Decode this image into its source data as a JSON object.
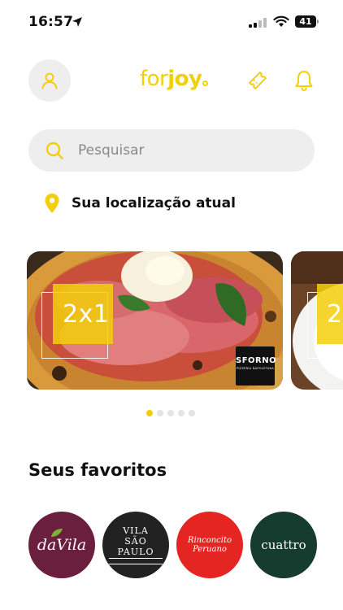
{
  "status_bar": {
    "time": "16:57",
    "battery": "41"
  },
  "header": {
    "logo_regular": "for",
    "logo_bold": "joy",
    "accent_color": "#f2cf0a"
  },
  "search": {
    "placeholder": "Pesquisar",
    "value": ""
  },
  "location": {
    "label": "Sua localização atual"
  },
  "carousel": {
    "banners": [
      {
        "promo": "2x1",
        "brand": "SFORNO",
        "brand_sub": "PIZZERIA NAPOLETANA"
      },
      {
        "promo": "2"
      }
    ],
    "page_count": 5,
    "active_index": 0
  },
  "favorites": {
    "title": "Seus favoritos",
    "items": [
      {
        "name": "daVila",
        "color": "#6b1f3e"
      },
      {
        "name": "VILA",
        "name_2": "SÃO PAULO",
        "color": "#222222"
      },
      {
        "name": "Rinconcito",
        "name_2": "Peruano",
        "color": "#e52521"
      },
      {
        "name": "cuattro",
        "color": "#153c2e"
      }
    ]
  },
  "icons": {
    "profile": "user-icon",
    "ticket": "ticket-icon",
    "notifications": "bell-icon",
    "search": "search-icon",
    "location": "map-pin-icon"
  }
}
